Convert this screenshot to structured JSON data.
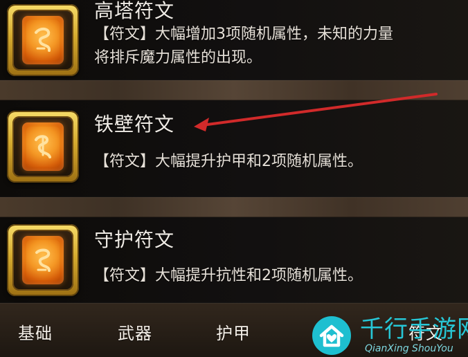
{
  "runes": [
    {
      "title": "高塔符文",
      "description_line_1": "【符文】大幅增加3项随机属性，未知的力量",
      "description_line_2": "将排斥魔力属性的出现。",
      "icon": "rune-icon"
    },
    {
      "title": "铁壁符文",
      "description_line_1": "【符文】大幅提升护甲和2项随机属性。",
      "icon": "rune-icon"
    },
    {
      "title": "守护符文",
      "description_line_1": "【符文】大幅提升抗性和2项随机属性。",
      "icon": "rune-icon"
    }
  ],
  "bottom_tabs": [
    {
      "label": "基础"
    },
    {
      "label": "武器"
    },
    {
      "label": "护甲"
    },
    {
      "label": "符文"
    }
  ],
  "watermark": {
    "title": "千行手游网",
    "subtitle": "QianXing ShouYou",
    "icon": "house-heart-icon"
  },
  "colors": {
    "accent_gold": "#d5aa2e",
    "rune_orange": "#f28b16",
    "arrow_red": "#d12a2a",
    "watermark_cyan": "#27c7d6"
  }
}
